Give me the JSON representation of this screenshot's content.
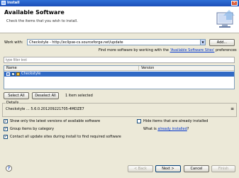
{
  "window": {
    "title": "Install",
    "close_glyph": "×"
  },
  "header": {
    "title": "Available Software",
    "description": "Check the items that you wish to install."
  },
  "work_with": {
    "label": "Work with:",
    "value": "Checkstyle - http://eclipse-cs.sourceforge.net/update",
    "add_label": "Add..."
  },
  "more_software": {
    "text": "Find more software by working with the ",
    "link": "'Available Software Sites'",
    "suffix": " preferences"
  },
  "filter": {
    "placeholder": "type filter text"
  },
  "tree": {
    "columns": [
      "Name",
      "Version"
    ],
    "rows": [
      {
        "expander": "+",
        "checked": true,
        "label": "Checkstyle"
      }
    ]
  },
  "selection": {
    "select_all": "Select All",
    "deselect_all": "Deselect All",
    "status": "1 item selected"
  },
  "details": {
    "legend": "Details",
    "text": "Checkstyle ... 5.6.0.201209221705-4MDZE7"
  },
  "options": [
    {
      "label": "Show only the latest versions of available software",
      "checked": true
    },
    {
      "label": "Group items by category",
      "checked": true
    },
    {
      "label": "Contact all update sites during install to find required software",
      "checked": true
    },
    {
      "label": "Hide items that are already installed",
      "checked": false
    }
  ],
  "already_installed": {
    "prefix": "What is ",
    "link": "already installed",
    "suffix": "?"
  },
  "buttons": {
    "back": "< Back",
    "next": "Next >",
    "cancel": "Cancel",
    "finish": "Finish"
  },
  "help_glyph": "?"
}
